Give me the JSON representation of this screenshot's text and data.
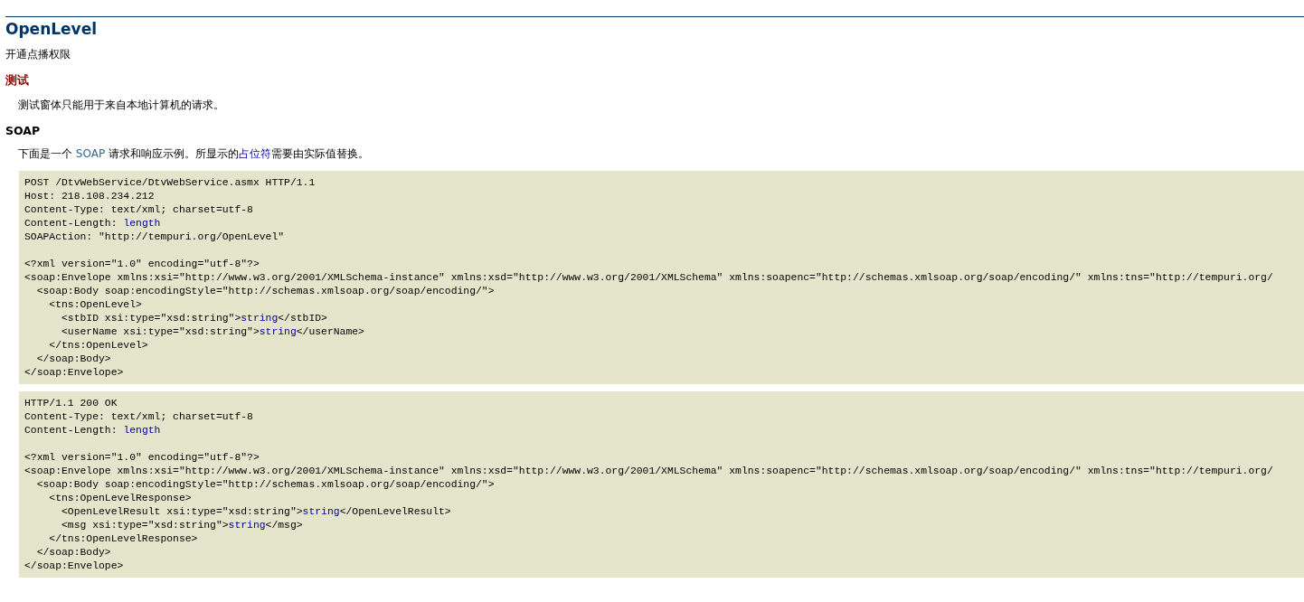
{
  "title": "OpenLevel",
  "description": "开通点播权限",
  "test_section": {
    "heading": "测试",
    "text": "测试窗体只能用于来自本地计算机的请求。"
  },
  "soap_section": {
    "heading": "SOAP",
    "intro": [
      {
        "text": "下面是一个 ",
        "kind": "literal"
      },
      {
        "text": "SOAP",
        "kind": "term"
      },
      {
        "text": " 请求和响应示例。所显示的",
        "kind": "literal"
      },
      {
        "text": "占位符",
        "kind": "placeholder"
      },
      {
        "text": "需要由实际值替换。",
        "kind": "literal"
      }
    ],
    "samples": [
      {
        "header_lines": [
          [
            {
              "text": "POST /DtvWebService/DtvWebService.asmx HTTP/1.1",
              "kind": "literal"
            }
          ],
          [
            {
              "text": "Host: 218.108.234.212",
              "kind": "literal"
            }
          ],
          [
            {
              "text": "Content-Type: text/xml; charset=utf-8",
              "kind": "literal"
            }
          ],
          [
            {
              "text": "Content-Length: ",
              "kind": "literal"
            },
            {
              "text": "length",
              "kind": "placeholder"
            }
          ],
          [
            {
              "text": "SOAPAction: \"http://tempuri.org/OpenLevel\"",
              "kind": "literal"
            }
          ]
        ],
        "body_lines": [
          [
            {
              "text": "<?xml version=\"1.0\" encoding=\"utf-8\"?>",
              "kind": "literal"
            }
          ],
          [
            {
              "text": "<soap:Envelope xmlns:xsi=\"http://www.w3.org/2001/XMLSchema-instance\" xmlns:xsd=\"http://www.w3.org/2001/XMLSchema\" xmlns:soapenc=\"http://schemas.xmlsoap.org/soap/encoding/\" xmlns:tns=\"http://tempuri.org/",
              "kind": "literal"
            }
          ],
          [
            {
              "text": "  <soap:Body soap:encodingStyle=\"http://schemas.xmlsoap.org/soap/encoding/\">",
              "kind": "literal"
            }
          ],
          [
            {
              "text": "    <tns:OpenLevel>",
              "kind": "literal"
            }
          ],
          [
            {
              "text": "      <stbID xsi:type=\"xsd:string\">",
              "kind": "literal"
            },
            {
              "text": "string",
              "kind": "placeholder"
            },
            {
              "text": "</stbID>",
              "kind": "literal"
            }
          ],
          [
            {
              "text": "      <userName xsi:type=\"xsd:string\">",
              "kind": "literal"
            },
            {
              "text": "string",
              "kind": "placeholder"
            },
            {
              "text": "</userName>",
              "kind": "literal"
            }
          ],
          [
            {
              "text": "    </tns:OpenLevel>",
              "kind": "literal"
            }
          ],
          [
            {
              "text": "  </soap:Body>",
              "kind": "literal"
            }
          ],
          [
            {
              "text": "</soap:Envelope>",
              "kind": "literal"
            }
          ]
        ]
      },
      {
        "header_lines": [
          [
            {
              "text": "HTTP/1.1 200 OK",
              "kind": "literal"
            }
          ],
          [
            {
              "text": "Content-Type: text/xml; charset=utf-8",
              "kind": "literal"
            }
          ],
          [
            {
              "text": "Content-Length: ",
              "kind": "literal"
            },
            {
              "text": "length",
              "kind": "placeholder"
            }
          ]
        ],
        "body_lines": [
          [
            {
              "text": "<?xml version=\"1.0\" encoding=\"utf-8\"?>",
              "kind": "literal"
            }
          ],
          [
            {
              "text": "<soap:Envelope xmlns:xsi=\"http://www.w3.org/2001/XMLSchema-instance\" xmlns:xsd=\"http://www.w3.org/2001/XMLSchema\" xmlns:soapenc=\"http://schemas.xmlsoap.org/soap/encoding/\" xmlns:tns=\"http://tempuri.org/",
              "kind": "literal"
            }
          ],
          [
            {
              "text": "  <soap:Body soap:encodingStyle=\"http://schemas.xmlsoap.org/soap/encoding/\">",
              "kind": "literal"
            }
          ],
          [
            {
              "text": "    <tns:OpenLevelResponse>",
              "kind": "literal"
            }
          ],
          [
            {
              "text": "      <OpenLevelResult xsi:type=\"xsd:string\">",
              "kind": "literal"
            },
            {
              "text": "string",
              "kind": "placeholder"
            },
            {
              "text": "</OpenLevelResult>",
              "kind": "literal"
            }
          ],
          [
            {
              "text": "      <msg xsi:type=\"xsd:string\">",
              "kind": "literal"
            },
            {
              "text": "string",
              "kind": "placeholder"
            },
            {
              "text": "</msg>",
              "kind": "literal"
            }
          ],
          [
            {
              "text": "    </tns:OpenLevelResponse>",
              "kind": "literal"
            }
          ],
          [
            {
              "text": "  </soap:Body>",
              "kind": "literal"
            }
          ],
          [
            {
              "text": "</soap:Envelope>",
              "kind": "literal"
            }
          ]
        ]
      }
    ]
  }
}
